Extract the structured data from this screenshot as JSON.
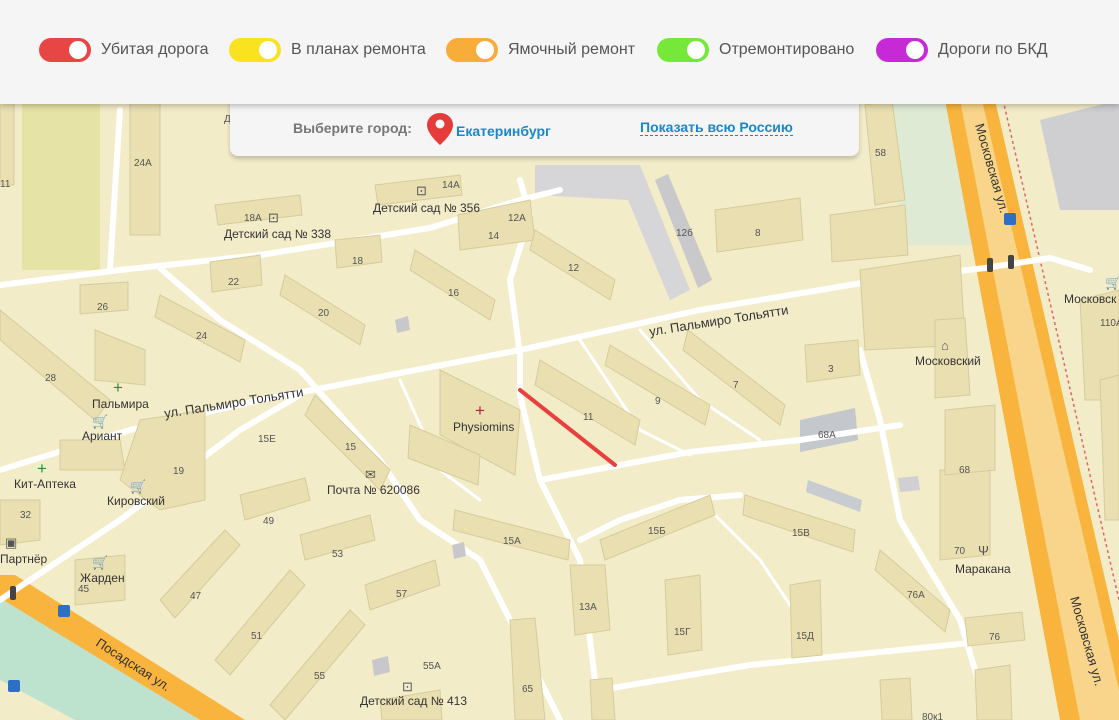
{
  "legend": [
    {
      "label": "Убитая дорога",
      "color": "#e84545"
    },
    {
      "label": "В планах ремонта",
      "color": "#f9e21f"
    },
    {
      "label": "Ямочный ремонт",
      "color": "#f8ac3a"
    },
    {
      "label": "Отремонтировано",
      "color": "#76e83a"
    },
    {
      "label": "Дороги по БКД",
      "color": "#c52ad6"
    }
  ],
  "city_selector": {
    "prompt": "Выберите город:",
    "city": "Екатеринбург",
    "show_all": "Показать всю Россию"
  },
  "map": {
    "streets": {
      "palmiro_upper": "ул. Пальмиро Тольятти",
      "palmiro_lower": "ул. Пальмиро Тольятти",
      "moskovskaya_upper": "Московская ул.",
      "moskovskaya_lower": "Московская ул.",
      "posadskaya": "Посадская ул."
    },
    "pois": {
      "kindergarten_356": "Детский сад № 356",
      "kindergarten_338": "Детский сад № 338",
      "kindergarten_413": "Детский сад № 413",
      "physiomins": "Physiomins",
      "post": "Почта № 620086",
      "palmira": "Пальмира",
      "ariant": "Ариант",
      "kit_apteka": "Кит-Аптека",
      "kirovsky": "Кировский",
      "partner": "Партнёр",
      "zharden": "Жарден",
      "moskovsky": "Московский",
      "maracana": "Маракана",
      "moskovsky_right": "Московск"
    },
    "buildings": {
      "b14a": "14А",
      "b18a": "18А",
      "b24a": "24А",
      "b12a": "12А",
      "b14": "14",
      "b18": "18",
      "b22": "22",
      "b16": "16",
      "b12": "12",
      "b12b": "12б",
      "b8": "8",
      "b58": "58",
      "b26": "26",
      "b20": "20",
      "b24": "24",
      "b28": "28",
      "b11": "11",
      "b9": "9",
      "b7": "7",
      "b3": "3",
      "b68a": "68А",
      "b68": "68",
      "b15e": "15Е",
      "b15": "15",
      "b19": "19",
      "b15a": "15А",
      "b15b": "15Б",
      "b15v": "15В",
      "b49": "49",
      "b53": "53",
      "b57": "57",
      "b47": "47",
      "b51": "51",
      "b55": "55",
      "b55a": "55А",
      "b13a": "13А",
      "b15g": "15Г",
      "b15d": "15Д",
      "b76a": "76А",
      "b76": "76",
      "b70": "70",
      "b65": "65",
      "b32": "32",
      "b45": "45",
      "b110a": "110А",
      "b11l": "11",
      "b80k1": "80к1",
      "b_d": "Д"
    },
    "damaged_road_color": "#e8403e"
  }
}
